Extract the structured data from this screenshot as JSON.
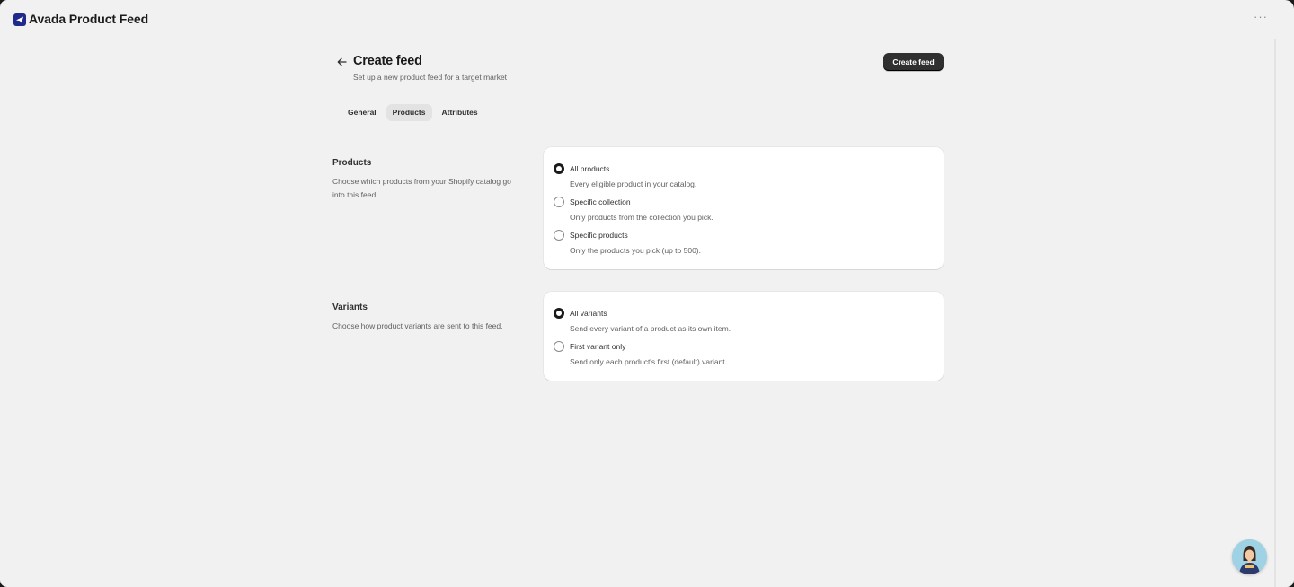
{
  "app": {
    "title": "Avada Product Feed",
    "more_label": "···"
  },
  "header": {
    "title": "Create feed",
    "subtitle": "Set up a new product feed for a target market",
    "primary_action": "Create feed"
  },
  "tabs": [
    {
      "label": "General",
      "active": false
    },
    {
      "label": "Products",
      "active": true
    },
    {
      "label": "Attributes",
      "active": false
    }
  ],
  "products_section": {
    "title": "Products",
    "description": "Choose which products from your Shopify catalog go into this feed.",
    "options": [
      {
        "label": "All products",
        "help": "Every eligible product in your catalog.",
        "checked": true
      },
      {
        "label": "Specific collection",
        "help": "Only products from the collection you pick.",
        "checked": false
      },
      {
        "label": "Specific products",
        "help": "Only the products you pick (up to 500).",
        "checked": false
      }
    ]
  },
  "variants_section": {
    "title": "Variants",
    "description": "Choose how product variants are sent to this feed.",
    "options": [
      {
        "label": "All variants",
        "help": "Send every variant of a product as its own item.",
        "checked": true
      },
      {
        "label": "First variant only",
        "help": "Send only each product's first (default) variant.",
        "checked": false
      }
    ]
  },
  "colors": {
    "page_bg": "#f1f1f1",
    "card_bg": "#ffffff",
    "primary_button": "#303030",
    "brand": "#1f2a8a"
  },
  "icons": {
    "logo": "avada-logo-icon",
    "back": "arrow-left-icon",
    "more": "more-horizontal-icon",
    "avatar": "support-avatar"
  }
}
